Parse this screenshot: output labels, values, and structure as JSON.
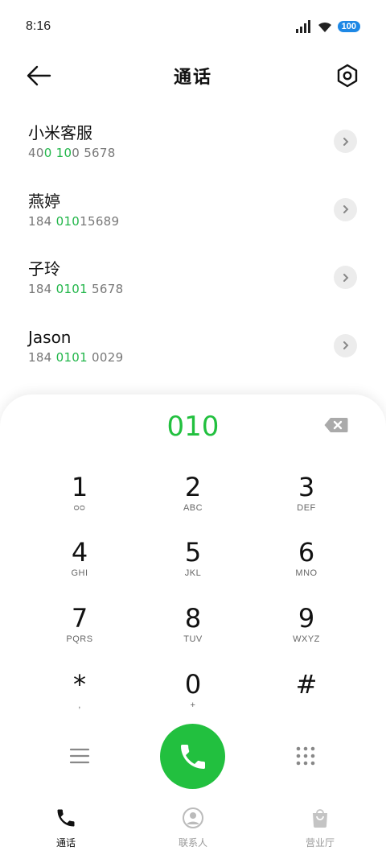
{
  "status_bar": {
    "time": "8:16",
    "battery": "100"
  },
  "header": {
    "title": "通话"
  },
  "contacts": [
    {
      "name": "小米客服",
      "number_pre": "40",
      "number_hl": "0 10",
      "number_post": "0 5678"
    },
    {
      "name": "燕婷",
      "number_pre": "184 ",
      "number_hl": "010",
      "number_post": "15689"
    },
    {
      "name": "子玲",
      "number_pre": "184 ",
      "number_hl": "0101",
      "number_post": " 5678"
    },
    {
      "name": "Jason",
      "number_pre": "184 ",
      "number_hl": "0101",
      "number_post": " 0029"
    }
  ],
  "dialer": {
    "input": "010",
    "keys": [
      {
        "num": "1",
        "sub": "ᴑᴑ"
      },
      {
        "num": "2",
        "sub": "ABC"
      },
      {
        "num": "3",
        "sub": "DEF"
      },
      {
        "num": "4",
        "sub": "GHI"
      },
      {
        "num": "5",
        "sub": "JKL"
      },
      {
        "num": "6",
        "sub": "MNO"
      },
      {
        "num": "7",
        "sub": "PQRS"
      },
      {
        "num": "8",
        "sub": "TUV"
      },
      {
        "num": "9",
        "sub": "WXYZ"
      },
      {
        "num": "*",
        "sub": ","
      },
      {
        "num": "0",
        "sub": "+"
      },
      {
        "num": "#",
        "sub": ""
      }
    ]
  },
  "bottom_nav": {
    "items": [
      {
        "label": "通话",
        "active": true
      },
      {
        "label": "联系人",
        "active": false
      },
      {
        "label": "营业厅",
        "active": false
      }
    ]
  },
  "colors": {
    "accent": "#22c03f",
    "highlight": "#22b64a",
    "battery": "#1e88e5"
  }
}
